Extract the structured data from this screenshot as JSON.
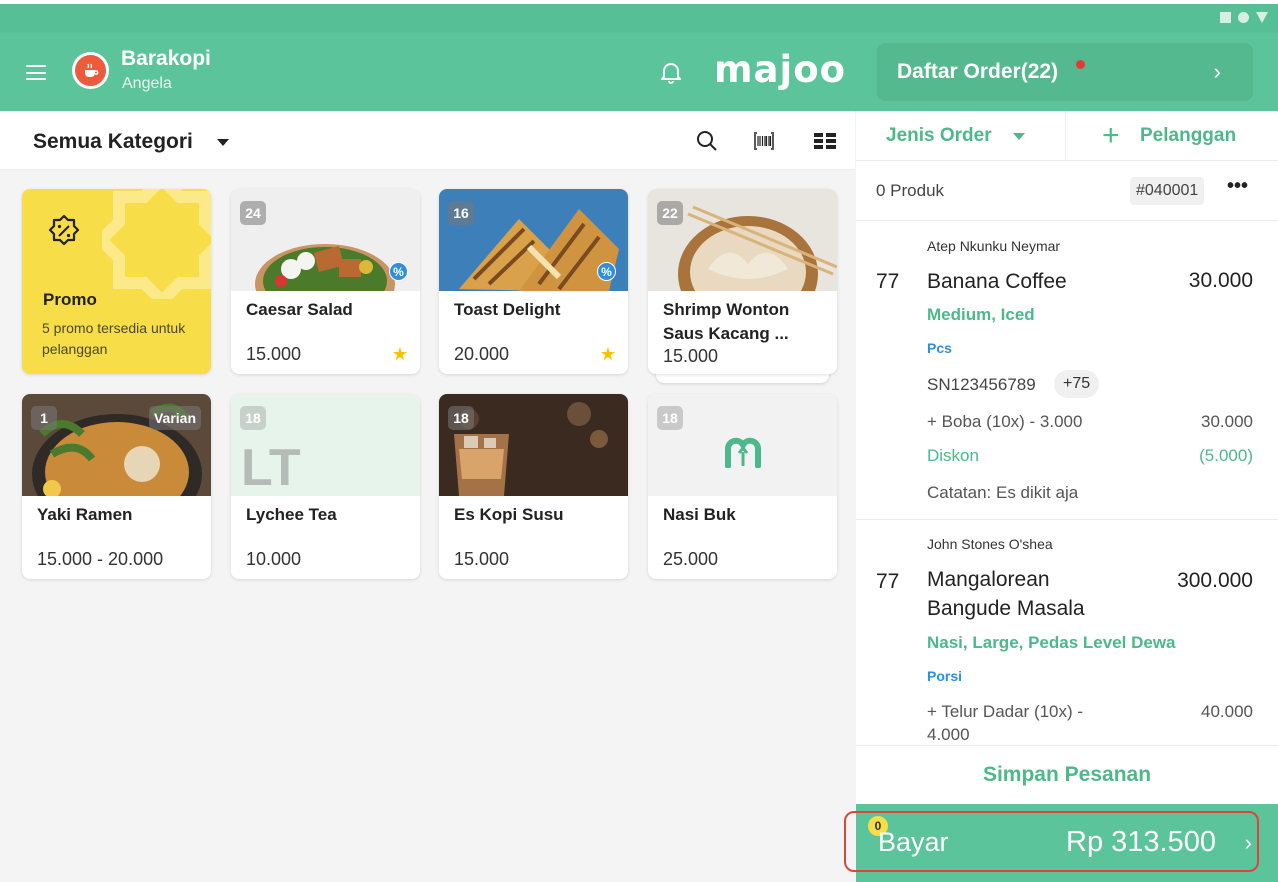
{
  "header": {
    "store_name": "Barakopi",
    "user_name": "Angela",
    "brand": "majoo",
    "order_list_label": "Daftar Order(22)",
    "accent": "#5cc49a"
  },
  "category_bar": {
    "label": "Semua Kategori"
  },
  "promo": {
    "title": "Promo",
    "subtitle": "5 promo tersedia untuk pelanggan"
  },
  "products": [
    {
      "name": "Caesar Salad",
      "stock": "24",
      "price": "15.000"
    },
    {
      "name": "Toast Delight",
      "stock": "16",
      "price": "20.000"
    },
    {
      "name": "Shrimp Wonton Saus Kacang ...",
      "stock": "22",
      "price": "15.000"
    },
    {
      "name": "Yaki Ramen",
      "stock": "1",
      "price": "15.000 - 20.000",
      "badge": "Varian"
    },
    {
      "name": "Lychee Tea",
      "stock": "18",
      "price": "10.000",
      "initials": "LT"
    },
    {
      "name": "Es Kopi Susu",
      "stock": "18",
      "price": "15.000"
    },
    {
      "name": "Nasi Buk",
      "stock": "18",
      "price": "25.000"
    }
  ],
  "order_panel": {
    "jenis_order": "Jenis Order",
    "pelanggan": "Pelanggan",
    "product_count": "0 Produk",
    "order_number": "#040001",
    "items": [
      {
        "staff": "Atep  Nkunku  Neymar",
        "qty": "77",
        "name": "Banana Coffee",
        "price": "30.000",
        "variant": "Medium, Iced",
        "unit": "Pcs",
        "serial": "SN123456789",
        "serial_more": "+75",
        "addon": "+ Boba (10x) - 3.000",
        "addon_price": "30.000",
        "discount_label": "Diskon",
        "discount_value": "(5.000)",
        "note": "Catatan: Es dikit aja"
      },
      {
        "staff": "John  Stones  O'shea",
        "qty": "77",
        "name": "Mangalorean Bangude Masala",
        "price": "300.000",
        "variant": "Nasi, Large, Pedas Level Dewa",
        "unit": "Porsi",
        "addon": "+ Telur Dadar (10x) - 4.000",
        "addon_price": "40.000"
      }
    ],
    "save_label": "Simpan Pesanan",
    "pay_label": "Bayar",
    "pay_amount": "Rp 313.500",
    "pay_badge": "0"
  }
}
